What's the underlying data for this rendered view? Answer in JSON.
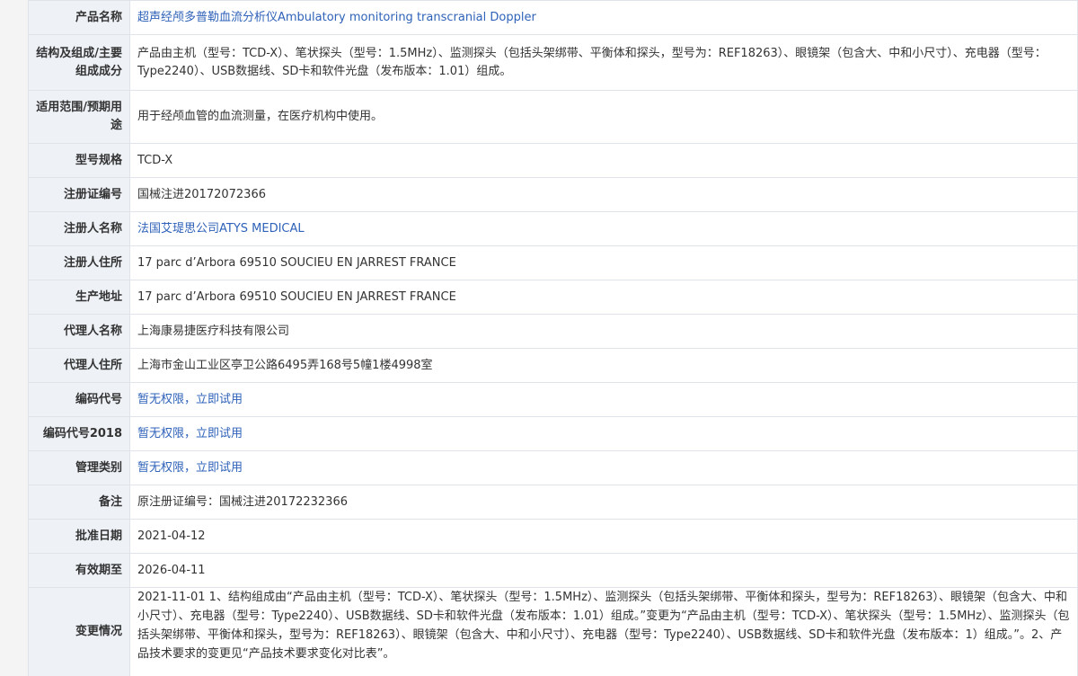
{
  "rows": {
    "product_name": {
      "label": "产品名称",
      "value": "超声经颅多普勒血流分析仪Ambulatory monitoring transcranial Doppler"
    },
    "structure": {
      "label": "结构及组成/主要组成成分",
      "value": "产品由主机（型号：TCD-X）、笔状探头（型号：1.5MHz）、监测探头（包括头架绑带、平衡体和探头，型号为：REF18263）、眼镜架（包含大、中和小尺寸）、充电器（型号：Type2240）、USB数据线、SD卡和软件光盘（发布版本：1.01）组成。"
    },
    "scope": {
      "label": "适用范围/预期用途",
      "value": "用于经颅血管的血流测量，在医疗机构中使用。"
    },
    "model": {
      "label": "型号规格",
      "value": "TCD-X"
    },
    "reg_no": {
      "label": "注册证编号",
      "value": "国械注进20172072366"
    },
    "registrant": {
      "label": "注册人名称",
      "value": "法国艾瑅思公司ATYS MEDICAL"
    },
    "registrant_addr": {
      "label": "注册人住所",
      "value": "17 parc d’Arbora 69510 SOUCIEU EN JARREST FRANCE"
    },
    "mfg_addr": {
      "label": "生产地址",
      "value": "17 parc d’Arbora 69510 SOUCIEU EN JARREST FRANCE"
    },
    "agent": {
      "label": "代理人名称",
      "value": "上海康易捷医疗科技有限公司"
    },
    "agent_addr": {
      "label": "代理人住所",
      "value": "上海市金山工业区亭卫公路6495弄168号5幢1楼4998室"
    },
    "code": {
      "label": "编码代号",
      "value": "暂无权限，立即试用"
    },
    "code2018": {
      "label": "编码代号2018",
      "value": "暂无权限，立即试用"
    },
    "mgmt_class": {
      "label": "管理类别",
      "value": "暂无权限，立即试用"
    },
    "remark": {
      "label": "备注",
      "value": "原注册证编号：国械注进20172232366"
    },
    "approve_date": {
      "label": "批准日期",
      "value": "2021-04-12"
    },
    "expiry": {
      "label": "有效期至",
      "value": "2026-04-11"
    },
    "changes": {
      "label": "变更情况",
      "value": "2021-11-01 1、结构组成由“产品由主机（型号：TCD-X）、笔状探头（型号：1.5MHz）、监测探头（包括头架绑带、平衡体和探头，型号为：REF18263）、眼镜架（包含大、中和小尺寸）、充电器（型号：Type2240）、USB数据线、SD卡和软件光盘（发布版本：1.01）组成。”变更为“产品由主机（型号：TCD-X）、笔状探头（型号：1.5MHz）、监测探头（包括头架绑带、平衡体和探头，型号为：REF18263）、眼镜架（包含大、中和小尺寸）、充电器（型号：Type2240）、USB数据线、SD卡和软件光盘（发布版本：1）组成。”。2、产品技术要求的变更见“产品技术要求变化对比表”。"
    }
  },
  "colors": {
    "label_bg": "#eef2f7",
    "border": "#e0e4ea",
    "link": "#2f62b9",
    "text": "#333333"
  }
}
